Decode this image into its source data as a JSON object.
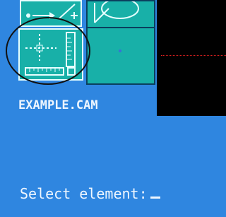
{
  "toolbox": {
    "upper_left_tool": "cutting-tool-icon",
    "upper_right_tool": "circle-tool-icon",
    "selected_tool": "grid-ruler-icon",
    "empty_tool": "point-icon"
  },
  "file": {
    "name": "EXAMPLE.CAM"
  },
  "command": {
    "prompt": "Select element:"
  },
  "colors": {
    "background": "#2f86e0",
    "tile": "#18b0a8",
    "highlight": "#e6ffff",
    "viewport": "#000000",
    "dotline": "#e02020"
  }
}
